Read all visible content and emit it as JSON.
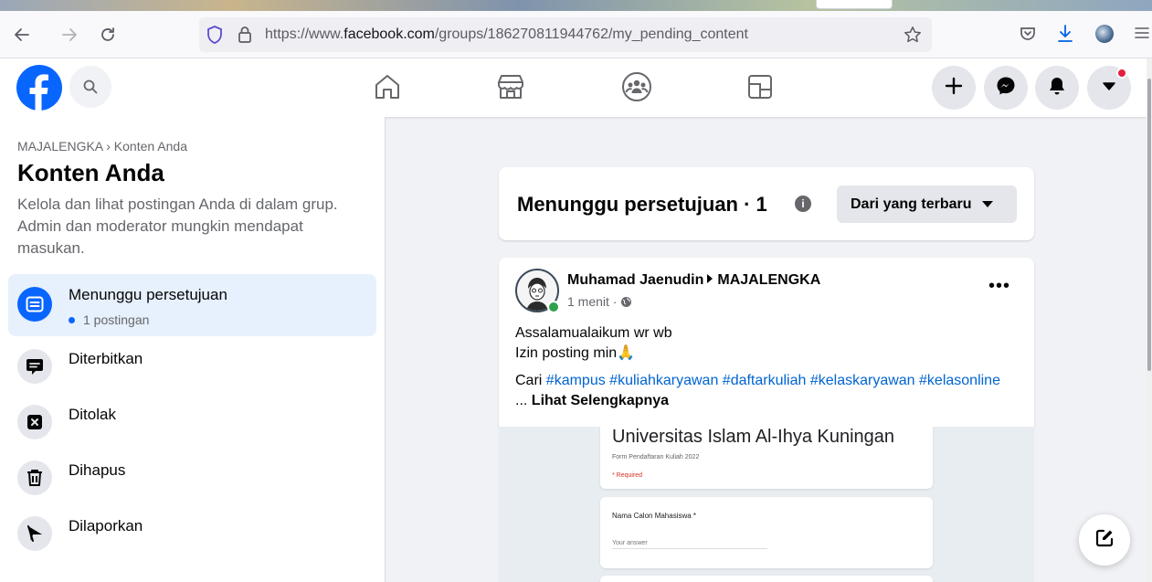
{
  "browser": {
    "url_prefix": "https://www.",
    "url_domain": "facebook.com",
    "url_path": "/groups/186270811944762/my_pending_content",
    "icons": [
      "back-icon",
      "forward-icon",
      "reload-icon",
      "shield-icon",
      "lock-icon",
      "star-icon",
      "pocket-icon",
      "download-icon",
      "profile-icon",
      "menu-icon"
    ]
  },
  "header": {
    "nav_icons": [
      "home-icon",
      "marketplace-icon",
      "groups-icon",
      "gaming-icon"
    ],
    "action_icons": [
      "plus-icon",
      "messenger-icon",
      "bell-icon",
      "caret-down-icon"
    ]
  },
  "sidebar": {
    "breadcrumb": "MAJALENGKA › Konten Anda",
    "title": "Konten Anda",
    "description": "Kelola dan lihat postingan Anda di dalam grup. Admin dan moderator mungkin mendapat masukan.",
    "items": [
      {
        "label": "Menunggu persetujuan",
        "sub": "1 postingan",
        "icon": "pending-icon"
      },
      {
        "label": "Diterbitkan",
        "icon": "published-icon"
      },
      {
        "label": "Ditolak",
        "icon": "declined-icon"
      },
      {
        "label": "Dihapus",
        "icon": "trash-icon"
      },
      {
        "label": "Dilaporkan",
        "icon": "flag-icon"
      }
    ]
  },
  "pending": {
    "title": "Menunggu persetujuan · 1",
    "sort_label": "Dari yang terbaru"
  },
  "post": {
    "author": "Muhamad Jaenudin",
    "group": "MAJALENGKA",
    "time": "1 menit ·",
    "line1": "Assalamualaikum wr wb",
    "line2": "Izin posting min🙏",
    "text_prefix": "Cari",
    "hashtags": "#kampus #kuliahkaryawan #daftarkuliah #kelaskaryawan #kelasonline",
    "ellipsis": "...",
    "see_more": "Lihat Selengkapnya",
    "more_label": "•••"
  },
  "form_image": {
    "title": "Universitas Islam Al-Ihya Kuningan",
    "subtitle": "Form Pendaftaran Kuliah 2022",
    "required": "* Required",
    "question": "Nama Calon Mahasiswa *",
    "answer_placeholder": "Your answer"
  },
  "colors": {
    "brand": "#0866ff",
    "hashtag": "#0064d1",
    "active_bg": "#e7f0fd",
    "online": "#31a24c",
    "notification": "#e41e3f"
  }
}
